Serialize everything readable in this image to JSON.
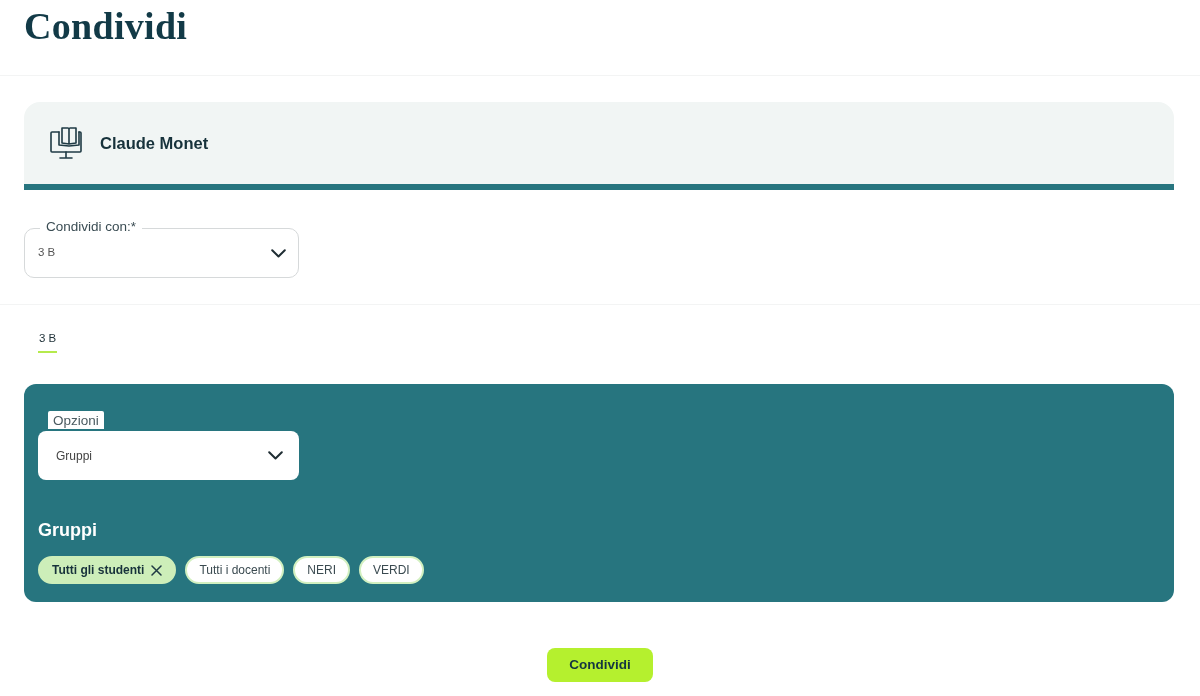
{
  "page_title": "Condividi",
  "resource": {
    "title": "Claude Monet"
  },
  "share_with": {
    "label": "Condividi con:*",
    "value": "3 B"
  },
  "class_tabs": [
    {
      "label": "3 B",
      "selected": true
    }
  ],
  "options": {
    "label": "Opzioni",
    "value": "Gruppi"
  },
  "groups": {
    "title": "Gruppi",
    "items": [
      {
        "label": "Tutti gli studenti",
        "selected": true
      },
      {
        "label": "Tutti i docenti",
        "selected": false
      },
      {
        "label": "NERI",
        "selected": false
      },
      {
        "label": "VERDI",
        "selected": false
      }
    ]
  },
  "submit_button": "Condividi"
}
